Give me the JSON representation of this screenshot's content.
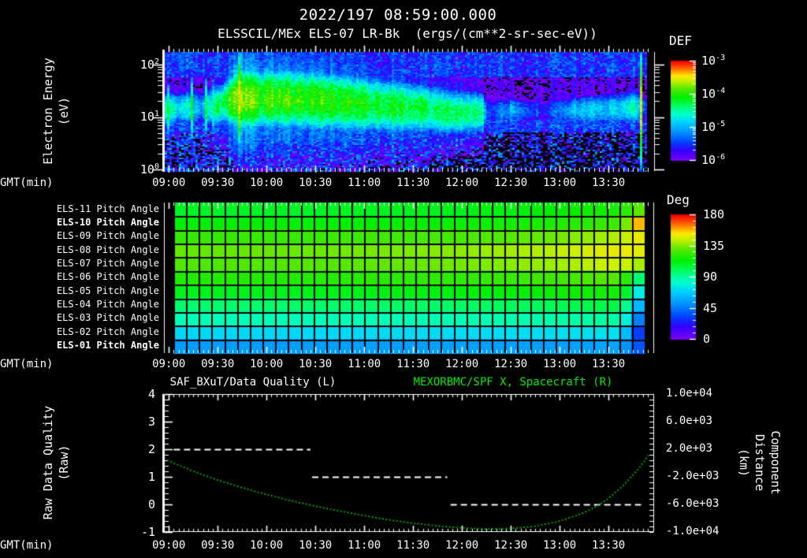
{
  "title": {
    "datetime": "2022/197 08:59:00.000",
    "instrument": "ELSSCIL/MEx ELS-07 LR-Bk  (ergs/(cm**2-sr-sec-eV))"
  },
  "x_axis": {
    "label": "GMT(min)",
    "tick_labels": [
      "09:00",
      "09:30",
      "10:00",
      "10:30",
      "11:00",
      "11:30",
      "12:00",
      "12:30",
      "13:00",
      "13:30"
    ],
    "major_tick_min": 30,
    "minor_tick_min": 3,
    "start_time": "08:59",
    "end_time": "13:57"
  },
  "panels": {
    "spectrogram": {
      "ylabel_line1": "Electron Energy",
      "ylabel_line2": "(eV)",
      "y_ticks": [
        {
          "m": "10",
          "e": "2"
        },
        {
          "m": "10",
          "e": "1"
        },
        {
          "m": "10",
          "e": "0"
        }
      ],
      "colorbar": {
        "title": "DEF",
        "tick_labels": [
          {
            "m": "10",
            "e": "-3"
          },
          {
            "m": "10",
            "e": "-4"
          },
          {
            "m": "10",
            "e": "-5"
          },
          {
            "m": "10",
            "e": "-6"
          }
        ]
      }
    },
    "pitch": {
      "colorbar": {
        "title": "Deg",
        "tick_labels": [
          "180",
          "135",
          "90",
          "45",
          "0"
        ]
      }
    },
    "line": {
      "title_left": "SAF_BXuT/Data Quality (L)",
      "title_right": "MEXORBMC/SPF X, Spacecraft (R)",
      "ylabel_left_line1": "Raw Data Quality",
      "ylabel_left_line2": "(Raw)",
      "ylabel_right_line1": "Component Distance",
      "ylabel_right_line2": "(km)",
      "left_tick_labels": [
        "4",
        "3",
        "2",
        "1",
        "0",
        "-1"
      ],
      "right_tick_labels": [
        "1.0e+04",
        "6.0e+03",
        "2.0e+03",
        "-2.0e+03",
        "-6.0e+03",
        "-1.0e+04"
      ]
    }
  },
  "colors": {
    "background": "#000000",
    "text": "#ffffff",
    "accent_green": "#00ee00",
    "curve_green": "#00c000",
    "colormap": [
      [
        0.0,
        "#7a00f5"
      ],
      [
        0.1,
        "#3300ff"
      ],
      [
        0.18,
        "#0040ff"
      ],
      [
        0.28,
        "#0090ff"
      ],
      [
        0.38,
        "#00d0ff"
      ],
      [
        0.46,
        "#00ffd0"
      ],
      [
        0.54,
        "#00ff70"
      ],
      [
        0.63,
        "#00f000"
      ],
      [
        0.72,
        "#55e800"
      ],
      [
        0.8,
        "#c8f000"
      ],
      [
        0.85,
        "#ffe800"
      ],
      [
        0.9,
        "#ff9000"
      ],
      [
        0.95,
        "#ff4000"
      ],
      [
        1.0,
        "#e80000"
      ]
    ]
  },
  "chart_data": [
    {
      "type": "heatmap",
      "name": "electron-energy-spectrogram",
      "title": "ELSSCIL/MEx ELS-07 LR-Bk",
      "units": "ergs/(cm**2-sr-sec-eV)",
      "xlabel": "GMT(min)",
      "ylabel": "Electron Energy (eV)",
      "x_range": [
        "08:59",
        "13:57"
      ],
      "y_range_ev": [
        1,
        170
      ],
      "y_scale": "log",
      "color_scale": {
        "label": "DEF",
        "min": 1e-06,
        "max": 0.001,
        "scale": "log"
      },
      "band_peak_log10_flux": [
        [
          0,
          -4.5
        ],
        [
          4,
          -4.6
        ],
        [
          8,
          -4.85
        ],
        [
          13,
          -4.7
        ],
        [
          18,
          -4.95
        ],
        [
          22,
          -5.0
        ],
        [
          26,
          -4.5
        ],
        [
          33,
          -4.25
        ],
        [
          40,
          -3.9
        ],
        [
          44,
          -3.65
        ],
        [
          50,
          -3.8
        ],
        [
          58,
          -3.95
        ],
        [
          68,
          -3.9
        ],
        [
          80,
          -4.0
        ],
        [
          95,
          -3.95
        ],
        [
          110,
          -4.05
        ],
        [
          125,
          -4.1
        ],
        [
          140,
          -4.15
        ],
        [
          152,
          -4.2
        ],
        [
          163,
          -4.35
        ],
        [
          172,
          -4.3
        ],
        [
          180,
          -4.3
        ],
        [
          188,
          -4.35
        ],
        [
          194,
          -4.5
        ],
        [
          197,
          -5.35
        ],
        [
          203,
          -5.35
        ],
        [
          212,
          -5.0
        ],
        [
          222,
          -5.3
        ],
        [
          232,
          -5.55
        ],
        [
          242,
          -5.25
        ],
        [
          252,
          -4.95
        ],
        [
          262,
          -4.8
        ],
        [
          270,
          -4.95
        ],
        [
          278,
          -4.75
        ],
        [
          286,
          -4.55
        ],
        [
          289,
          -4.7
        ],
        [
          292,
          -5.1
        ],
        [
          295,
          -5.7
        ],
        [
          297,
          -5.3
        ]
      ],
      "band_center_log10_ev": [
        [
          0,
          1.15
        ],
        [
          30,
          1.2
        ],
        [
          42,
          1.35
        ],
        [
          70,
          1.35
        ],
        [
          100,
          1.3
        ],
        [
          130,
          1.22
        ],
        [
          160,
          1.15
        ],
        [
          175,
          1.08
        ],
        [
          195,
          1.08
        ],
        [
          212,
          1.12
        ],
        [
          250,
          1.12
        ],
        [
          297,
          1.18
        ]
      ],
      "band_width_decades": [
        [
          0,
          0.3
        ],
        [
          35,
          0.35
        ],
        [
          45,
          0.5
        ],
        [
          90,
          0.5
        ],
        [
          140,
          0.45
        ],
        [
          170,
          0.4
        ],
        [
          195,
          0.35
        ],
        [
          212,
          0.28
        ],
        [
          297,
          0.3
        ]
      ],
      "spikes_t_flux_w_escale": [
        [
          0.5,
          -4.35,
          2,
          1.5
        ],
        [
          15.5,
          -3.9,
          0.9,
          1.6
        ],
        [
          24,
          -4.15,
          0.9,
          1.5
        ],
        [
          28,
          -4.25,
          0.9,
          1.5
        ],
        [
          32,
          -4.05,
          1.1,
          1.5
        ],
        [
          36,
          -4.15,
          0.9,
          1.5
        ],
        [
          44,
          -3.6,
          2.5,
          1.5
        ],
        [
          199,
          -4.65,
          0.8,
          1.8
        ],
        [
          291,
          -3.5,
          1.4,
          3.0
        ]
      ],
      "low_energy_floor_log10_flux": -5.55,
      "background_log10_flux": -5.95
    },
    {
      "type": "heatmap",
      "name": "pitch-angle-rows",
      "color_scale": {
        "label": "Deg",
        "min": 0,
        "max": 180
      },
      "grid_columns": 37,
      "times_frac": [
        0,
        0.3,
        0.6,
        0.8,
        0.95,
        1.0
      ],
      "rows": [
        {
          "label": "ELS-11 Pitch Angle",
          "bold": false,
          "angles_deg": [
            108,
            108,
            110,
            113,
            118,
            135
          ]
        },
        {
          "label": "ELS-10 Pitch Angle",
          "bold": true,
          "angles_deg": [
            113,
            113,
            115,
            118,
            125,
            170
          ]
        },
        {
          "label": "ELS-09 Pitch Angle",
          "bold": false,
          "angles_deg": [
            123,
            124,
            127,
            132,
            142,
            152
          ]
        },
        {
          "label": "ELS-08 Pitch Angle",
          "bold": false,
          "angles_deg": [
            131,
            132,
            136,
            142,
            150,
            148
          ]
        },
        {
          "label": "ELS-07 Pitch Angle",
          "bold": false,
          "angles_deg": [
            128,
            129,
            133,
            138,
            146,
            138
          ]
        },
        {
          "label": "ELS-06 Pitch Angle",
          "bold": false,
          "angles_deg": [
            119,
            120,
            122,
            125,
            130,
            85
          ]
        },
        {
          "label": "ELS-05 Pitch Angle",
          "bold": false,
          "angles_deg": [
            110,
            110,
            112,
            115,
            118,
            63
          ]
        },
        {
          "label": "ELS-04 Pitch Angle",
          "bold": false,
          "angles_deg": [
            98,
            98,
            99,
            101,
            104,
            46
          ]
        },
        {
          "label": "ELS-03 Pitch Angle",
          "bold": false,
          "angles_deg": [
            86,
            86,
            87,
            88,
            90,
            31
          ]
        },
        {
          "label": "ELS-02 Pitch Angle",
          "bold": false,
          "angles_deg": [
            71,
            71,
            72,
            73,
            74,
            16
          ]
        },
        {
          "label": "ELS-01 Pitch Angle",
          "bold": true,
          "angles_deg": [
            54,
            54,
            55,
            55,
            56,
            30
          ]
        }
      ]
    },
    {
      "type": "line",
      "name": "quality-and-spacecraft-x",
      "ylim_left": [
        -1,
        4
      ],
      "ylim_right": [
        -10000,
        10000
      ],
      "series": [
        {
          "name": "SAF_BXuT/Data Quality",
          "axis": "left",
          "style": "dashed",
          "color": "#ffffff",
          "segments": [
            {
              "start_min": 4,
              "end_min": 88,
              "value": 2
            },
            {
              "start_min": 89,
              "end_min": 172,
              "value": 1
            },
            {
              "start_min": 174,
              "end_min": 291,
              "value": 0
            }
          ]
        },
        {
          "name": "MEXORBMC/SPF X, Spacecraft",
          "axis": "right",
          "style": "dotted",
          "color": "#00c000",
          "points_min_km": [
            [
              0,
              400
            ],
            [
              15,
              -1100
            ],
            [
              30,
              -2400
            ],
            [
              45,
              -3500
            ],
            [
              60,
              -4500
            ],
            [
              75,
              -5400
            ],
            [
              90,
              -6200
            ],
            [
              105,
              -6900
            ],
            [
              120,
              -7600
            ],
            [
              135,
              -8200
            ],
            [
              150,
              -8700
            ],
            [
              165,
              -9100
            ],
            [
              180,
              -9400
            ],
            [
              195,
              -9550
            ],
            [
              210,
              -9500
            ],
            [
              225,
              -9200
            ],
            [
              240,
              -8500
            ],
            [
              255,
              -7300
            ],
            [
              262,
              -6500
            ],
            [
              270,
              -5300
            ],
            [
              280,
              -3300
            ],
            [
              290,
              -700
            ],
            [
              296,
              1300
            ]
          ]
        }
      ]
    }
  ]
}
